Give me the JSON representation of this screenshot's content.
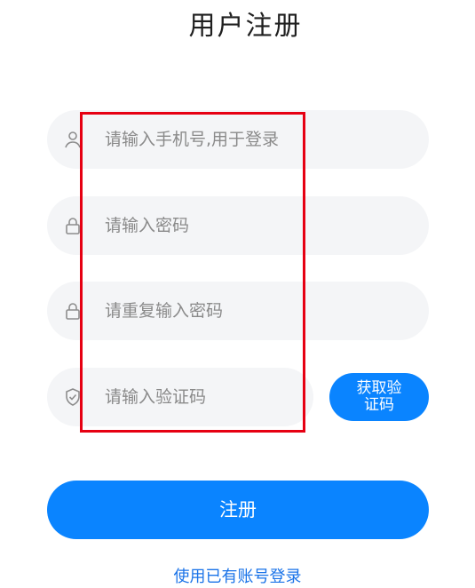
{
  "page": {
    "title": "用户注册"
  },
  "form": {
    "phone": {
      "placeholder": "请输入手机号,用于登录",
      "icon": "user-icon"
    },
    "password": {
      "placeholder": "请输入密码",
      "icon": "lock-icon"
    },
    "confirm_password": {
      "placeholder": "请重复输入密码",
      "icon": "lock-icon"
    },
    "verification_code": {
      "placeholder": "请输入验证码",
      "icon": "shield-check-icon",
      "get_code_label": "获取验证码"
    },
    "submit_label": "注册",
    "login_link_label": "使用已有账号登录"
  },
  "colors": {
    "accent": "#0a84ff",
    "field_background": "#f4f5f7",
    "highlight": "#e60012"
  }
}
